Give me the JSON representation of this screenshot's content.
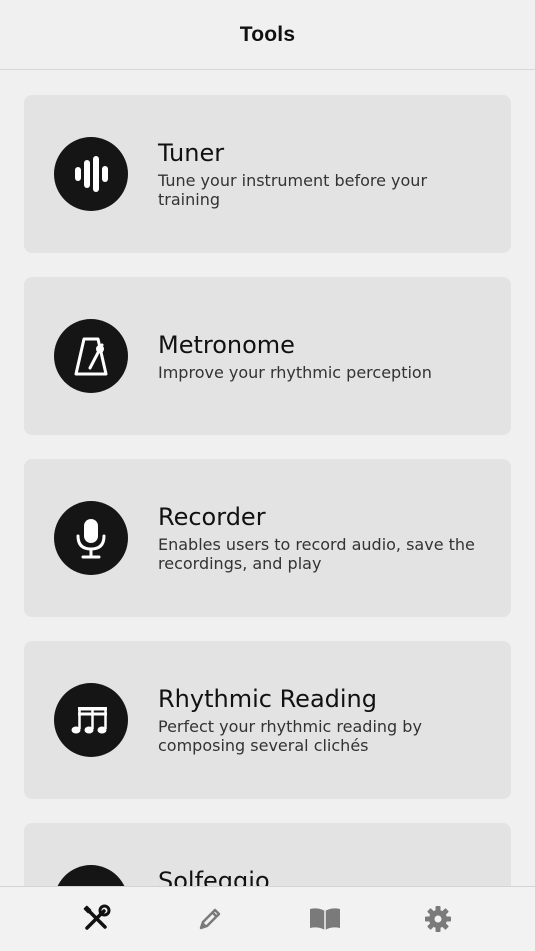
{
  "header": {
    "title": "Tools"
  },
  "tools": [
    {
      "title": "Tuner",
      "description": "Tune your instrument before your training",
      "icon": "sound-wave-icon"
    },
    {
      "title": "Metronome",
      "description": "Improve your rhythmic perception",
      "icon": "metronome-icon"
    },
    {
      "title": "Recorder",
      "description": "Enables users to record audio, save the recordings, and play",
      "icon": "microphone-icon"
    },
    {
      "title": "Rhythmic Reading",
      "description": "Perfect your rhythmic reading by composing several clichés",
      "icon": "music-notes-icon"
    },
    {
      "title": "Solfeggio",
      "description": "",
      "icon": "solfeggio-icon"
    }
  ],
  "tabbar": {
    "tabs": [
      {
        "icon": "tools-icon",
        "active": true
      },
      {
        "icon": "pencil-icon",
        "active": false
      },
      {
        "icon": "book-icon",
        "active": false
      },
      {
        "icon": "gear-icon",
        "active": false
      }
    ]
  },
  "colors": {
    "background": "#f0f0f0",
    "card": "#e3e3e3",
    "icon_circle": "#151515",
    "active_tab": "#111111",
    "inactive_tab": "#7a7a7a"
  }
}
